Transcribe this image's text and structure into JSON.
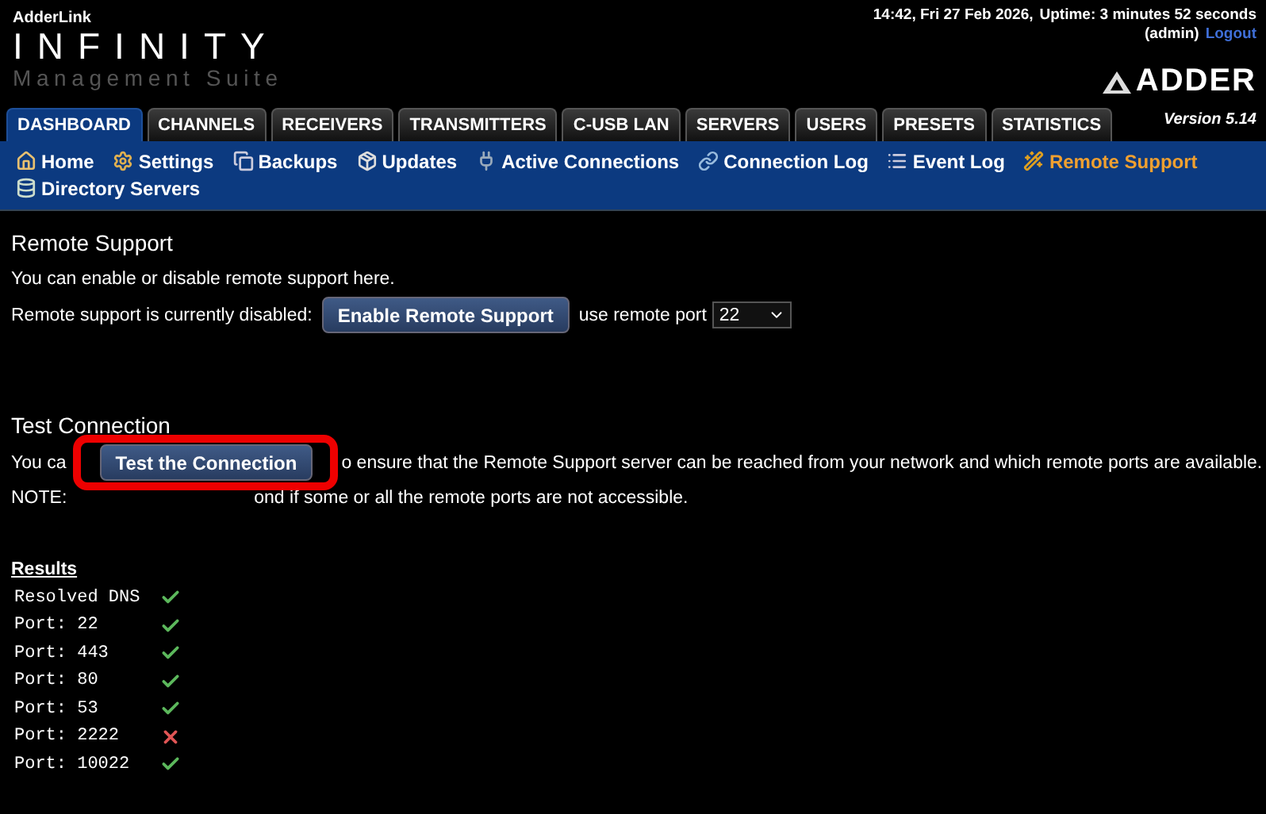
{
  "header": {
    "brand_small": "AdderLink",
    "brand_title": "INFINITY",
    "brand_subtitle": "Management Suite",
    "datetime": "14:42, Fri 27 Feb 2026,",
    "uptime": "Uptime: 3 minutes 52 seconds",
    "user": "(admin)",
    "logout": "Logout",
    "logo": "ADDER",
    "version": "Version 5.14"
  },
  "tabs": [
    {
      "label": "DASHBOARD",
      "selected": true
    },
    {
      "label": "CHANNELS",
      "selected": false
    },
    {
      "label": "RECEIVERS",
      "selected": false
    },
    {
      "label": "TRANSMITTERS",
      "selected": false
    },
    {
      "label": "C-USB LAN",
      "selected": false
    },
    {
      "label": "SERVERS",
      "selected": false
    },
    {
      "label": "USERS",
      "selected": false
    },
    {
      "label": "PRESETS",
      "selected": false
    },
    {
      "label": "STATISTICS",
      "selected": false
    }
  ],
  "subnav": [
    {
      "label": "Home",
      "selected": false
    },
    {
      "label": "Settings",
      "selected": false
    },
    {
      "label": "Backups",
      "selected": false
    },
    {
      "label": "Updates",
      "selected": false
    },
    {
      "label": "Active Connections",
      "selected": false
    },
    {
      "label": "Connection Log",
      "selected": false
    },
    {
      "label": "Event Log",
      "selected": false
    },
    {
      "label": "Remote Support",
      "selected": true
    },
    {
      "label": "Directory Servers",
      "selected": false
    }
  ],
  "remote_support": {
    "heading": "Remote Support",
    "intro": "You can enable or disable remote support here.",
    "status_text": "Remote support is currently disabled:",
    "button": "Enable Remote Support",
    "port_label": "use remote port",
    "port_value": "22"
  },
  "test_connection": {
    "heading": "Test Connection",
    "lead_fragment": "You ca",
    "button": "Test the Connection",
    "trail_fragment": "o ensure that the Remote Support server can be reached from your network and which remote ports are available.",
    "note_label": "NOTE:",
    "note_fragment": "ond if some or all the remote ports are not accessible."
  },
  "results": {
    "heading": "Results",
    "rows": [
      {
        "label": "Resolved DNS",
        "ok": true
      },
      {
        "label": "Port: 22",
        "ok": true
      },
      {
        "label": "Port: 443",
        "ok": true
      },
      {
        "label": "Port: 80",
        "ok": true
      },
      {
        "label": "Port: 53",
        "ok": true
      },
      {
        "label": "Port: 2222",
        "ok": false
      },
      {
        "label": "Port: 10022",
        "ok": true
      }
    ]
  }
}
